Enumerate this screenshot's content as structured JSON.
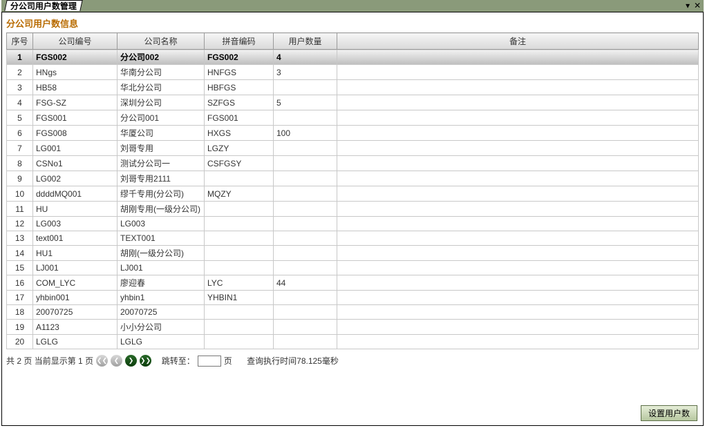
{
  "window": {
    "title": "分公司用户数管理"
  },
  "subtitle": "分公司用户数信息",
  "columns": [
    "序号",
    "公司编号",
    "公司名称",
    "拼音编码",
    "用户数量",
    "备注"
  ],
  "rows": [
    {
      "idx": "1",
      "code": "FGS002",
      "name": "分公司002",
      "py": "FGS002",
      "cnt": "4",
      "note": ""
    },
    {
      "idx": "2",
      "code": "HNgs",
      "name": "华南分公司",
      "py": "HNFGS",
      "cnt": "3",
      "note": ""
    },
    {
      "idx": "3",
      "code": "HB58",
      "name": "华北分公司",
      "py": "HBFGS",
      "cnt": "",
      "note": ""
    },
    {
      "idx": "4",
      "code": "FSG-SZ",
      "name": "深圳分公司",
      "py": "SZFGS",
      "cnt": "5",
      "note": ""
    },
    {
      "idx": "5",
      "code": "FGS001",
      "name": "分公司001",
      "py": "FGS001",
      "cnt": "",
      "note": ""
    },
    {
      "idx": "6",
      "code": "FGS008",
      "name": "华厦公司",
      "py": "HXGS",
      "cnt": "100",
      "note": ""
    },
    {
      "idx": "7",
      "code": "LG001",
      "name": "刘哥专用",
      "py": "LGZY",
      "cnt": "",
      "note": ""
    },
    {
      "idx": "8",
      "code": "CSNo1",
      "name": "测试分公司一",
      "py": "CSFGSY",
      "cnt": "",
      "note": ""
    },
    {
      "idx": "9",
      "code": "LG002",
      "name": "刘哥专用2111",
      "py": "",
      "cnt": "",
      "note": ""
    },
    {
      "idx": "10",
      "code": "ddddMQ001",
      "name": "缪千专用(分公司)",
      "py": "MQZY",
      "cnt": "",
      "note": ""
    },
    {
      "idx": "11",
      "code": "HU",
      "name": "胡刚专用(一级分公司)",
      "py": "",
      "cnt": "",
      "note": ""
    },
    {
      "idx": "12",
      "code": "LG003",
      "name": "LG003",
      "py": "",
      "cnt": "",
      "note": ""
    },
    {
      "idx": "13",
      "code": "text001",
      "name": "TEXT001",
      "py": "",
      "cnt": "",
      "note": ""
    },
    {
      "idx": "14",
      "code": "HU1",
      "name": "胡刚(一级分公司)",
      "py": "",
      "cnt": "",
      "note": ""
    },
    {
      "idx": "15",
      "code": "LJ001",
      "name": "LJ001",
      "py": "",
      "cnt": "",
      "note": ""
    },
    {
      "idx": "16",
      "code": "COM_LYC",
      "name": "廖迎春",
      "py": "LYC",
      "cnt": "44",
      "note": ""
    },
    {
      "idx": "17",
      "code": "yhbin001",
      "name": "yhbin1",
      "py": "YHBIN1",
      "cnt": "",
      "note": ""
    },
    {
      "idx": "18",
      "code": "20070725",
      "name": "20070725",
      "py": "",
      "cnt": "",
      "note": ""
    },
    {
      "idx": "19",
      "code": "A1123",
      "name": "小小分公司",
      "py": "",
      "cnt": "",
      "note": ""
    },
    {
      "idx": "20",
      "code": "LGLG",
      "name": "LGLG",
      "py": "",
      "cnt": "",
      "note": ""
    }
  ],
  "selected_row_index": 0,
  "pager": {
    "summary_prefix": "共 ",
    "total_pages": "2",
    "summary_mid": " 页 当前显示第 ",
    "current_page": "1",
    "summary_suffix": " 页",
    "jump_label_prefix": "跳转至：",
    "jump_label_suffix": "页",
    "jump_value": "",
    "timing_prefix": "查询执行时间",
    "timing_value": "78.125",
    "timing_suffix": "毫秒"
  },
  "buttons": {
    "set_user_count": "设置用户数"
  },
  "icons": {
    "dropdown": "▾",
    "close": "✕",
    "first": "❮❮",
    "prev": "❮",
    "next": "❯",
    "last": "❯❯"
  }
}
